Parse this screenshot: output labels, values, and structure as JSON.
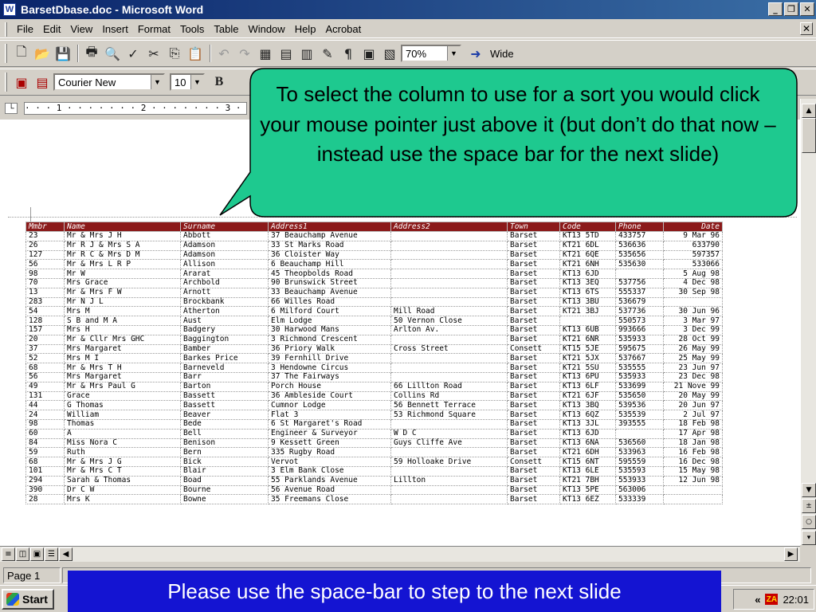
{
  "window": {
    "title": "BarsetDbase.doc - Microsoft Word",
    "app_icon": "word-document-icon",
    "buttons": [
      "_",
      "ᵗ",
      "X"
    ]
  },
  "menubar": {
    "items": [
      "File",
      "Edit",
      "View",
      "Insert",
      "Format",
      "Tools",
      "Table",
      "Window",
      "Help",
      "Acrobat"
    ],
    "close": "X"
  },
  "toolbar_standard": {
    "icons": [
      "new-document-icon",
      "open-folder-icon",
      "save-icon",
      "print-icon",
      "print-preview-icon",
      "spelling-icon",
      "cut-icon",
      "copy-icon",
      "paste-icon",
      "undo-icon",
      "redo-icon",
      "tables-borders-icon",
      "insert-table-icon",
      "columns-icon",
      "drawing-icon",
      "show-formatting-icon",
      "document-map-icon",
      "header-footer-icon"
    ],
    "zoom": "70%",
    "wide_label": "Wide"
  },
  "toolbar_formatting": {
    "font": "Courier New",
    "size": "10",
    "bold": "B"
  },
  "ruler": {
    "text": "· · · 1 · · · · · · · 2 · · · · · · · 3 ·"
  },
  "callout": {
    "text": "To select the column to use for a sort you would click your mouse pointer just above it (but don’t do that now – instead use the space bar for the next slide)",
    "fill": "#1ec98f",
    "stroke": "#000000"
  },
  "table": {
    "header_color": "#8b1a1a",
    "columns": [
      "Mmbr",
      "Name",
      "Surname",
      "Address1",
      "Address2",
      "Town",
      "Code",
      "Phone",
      "Date"
    ],
    "rows": [
      [
        "23",
        "Mr & Mrs J H",
        "Abbott",
        "37 Beauchamp Avenue",
        "",
        "Barset",
        "KT13 5TD",
        "433757",
        "9 Mar 96"
      ],
      [
        "26",
        "Mr R J & Mrs S A",
        "Adamson",
        "33 St Marks Road",
        "",
        "Barset",
        "KT21 6DL",
        "536636",
        "633790"
      ],
      [
        "127",
        "Mr R C & Mrs D M",
        "Adamson",
        "36 Cloister Way",
        "",
        "Barset",
        "KT21 6QE",
        "535656",
        "597357"
      ],
      [
        "56",
        "Mr & Mrs L R P",
        "Allison",
        "6 Beauchamp Hill",
        "",
        "Barset",
        "KT21 6NH",
        "535630",
        "533066"
      ],
      [
        "98",
        "Mr W",
        "Ararat",
        "45 Theopbolds Road",
        "",
        "Barset",
        "KT13 6JD",
        "",
        "5 Aug 98"
      ],
      [
        "70",
        "Mrs Grace",
        "Archbold",
        "90 Brunswick Street",
        "",
        "Barset",
        "KT13 3EQ",
        "537756",
        "4 Dec 98"
      ],
      [
        "13",
        "Mr & Mrs F W",
        "Arnott",
        "33 Beauchamp Avenue",
        "",
        "Barset",
        "KT13 6TS",
        "555337",
        "30 Sep 98"
      ],
      [
        "283",
        "Mr N J L",
        "Brockbank",
        "66 Willes Road",
        "",
        "Barset",
        "KT13 3BU",
        "536679",
        ""
      ],
      [
        "54",
        "Mrs M",
        "Atherton",
        "6 Milford Court",
        "Mill Road",
        "Barset",
        "KT21 3BJ",
        "537736",
        "30 Jun 96"
      ],
      [
        "128",
        "S B and M A",
        "Aust",
        "Elm Lodge",
        "50 Vernon Close",
        "Barset",
        "",
        "550573",
        "3 Mar 97"
      ],
      [
        "157",
        "Mrs H",
        "Badgery",
        "30 Harwood Mans",
        "Arlton Av.",
        "Barset",
        "KT13 6UB",
        "993666",
        "3 Dec 99"
      ],
      [
        "20",
        "Mr & Cllr Mrs GHC",
        "Baggington",
        "3 Richmond Crescent",
        "",
        "Barset",
        "KT21 6NR",
        "535933",
        "28 Oct 99"
      ],
      [
        "37",
        "Mrs Margaret",
        "Bamber",
        "36 Priory Walk",
        "Cross Street",
        "Consett",
        "KT15 5JE",
        "595675",
        "26 May 99"
      ],
      [
        "52",
        "Mrs M I",
        "Barkes Price",
        "39 Fernhill Drive",
        "",
        "Barset",
        "KT21 5JX",
        "537667",
        "25 May 99"
      ],
      [
        "68",
        "Mr & Mrs T H",
        "Barneveld",
        "3 Hendowne Circus",
        "",
        "Barset",
        "KT21 5SU",
        "535555",
        "23 Jun 97"
      ],
      [
        "56",
        "Mrs Margaret",
        "Barr",
        "37 The Fairways",
        "",
        "Barset",
        "KT13 6PU",
        "535933",
        "23 Dec 98"
      ],
      [
        "49",
        "Mr & Mrs Paul G",
        "Barton",
        "Porch House",
        "66 Lillton Road",
        "Barset",
        "KT13 6LF",
        "533699",
        "21 Nove 99"
      ],
      [
        "131",
        "Grace",
        "Bassett",
        "36 Ambleside Court",
        "Collins Rd",
        "Barset",
        "KT21 6JF",
        "535650",
        "20 May 99"
      ],
      [
        "44",
        "G Thomas",
        "Bassett",
        "Cumnor Lodge",
        "56 Bennett Terrace",
        "Barset",
        "KT13 3BQ",
        "539536",
        "20 Jun 97"
      ],
      [
        "24",
        "William",
        "Beaver",
        "Flat 3",
        "53 Richmond Square",
        "Barset",
        "KT13 6QZ",
        "535539",
        "2 Jul 97"
      ],
      [
        "98",
        "Thomas",
        "Bede",
        "6 St Margaret's Road",
        "",
        "Barset",
        "KT13 3JL",
        "393555",
        "18 Feb 98"
      ],
      [
        "60",
        "A",
        "Bell",
        "Engineer & Surveyor",
        "W D C",
        "Barset",
        "KT13 6JD",
        "",
        "17 Apr 98"
      ],
      [
        "84",
        "Miss Nora C",
        "Benison",
        "9 Kessett Green",
        "Guys Cliffe Ave",
        "Barset",
        "KT13 6NA",
        "536560",
        "18 Jan 98"
      ],
      [
        "59",
        "Ruth",
        "Bern",
        "335 Rugby Road",
        "",
        "Barset",
        "KT21 6DH",
        "533963",
        "16 Feb 98"
      ],
      [
        "68",
        "Mr & Mrs J G",
        "Bick",
        "Vervot",
        "59 Holloake Drive",
        "Consett",
        "KT15 6NT",
        "595559",
        "16 Dec 98"
      ],
      [
        "101",
        "Mr & Mrs C T",
        "Blair",
        "3 Elm Bank Close",
        "",
        "Barset",
        "KT13 6LE",
        "535593",
        "15 May 98"
      ],
      [
        "294",
        "Sarah & Thomas",
        "Boad",
        "55 Parklands Avenue",
        "Lillton",
        "Barset",
        "KT21 7BH",
        "553933",
        "12 Jun 98"
      ],
      [
        "390",
        "Dr C W",
        "Bourne",
        "56 Avenue Road",
        "",
        "Barset",
        "KT13 5PE",
        "563006",
        ""
      ],
      [
        "28",
        "Mrs K",
        "Bowne",
        "35 Freemans Close",
        "",
        "Barset",
        "KT13 6EZ",
        "533339",
        ""
      ]
    ]
  },
  "statusbar": {
    "page": "Page 1"
  },
  "taskbar": {
    "start_label": "Start",
    "tray_chevron": "«",
    "za_label": "ZA",
    "clock": "22:01"
  },
  "banner": {
    "text": "Please use the space-bar to step to the next slide",
    "color": "#1414d2"
  }
}
